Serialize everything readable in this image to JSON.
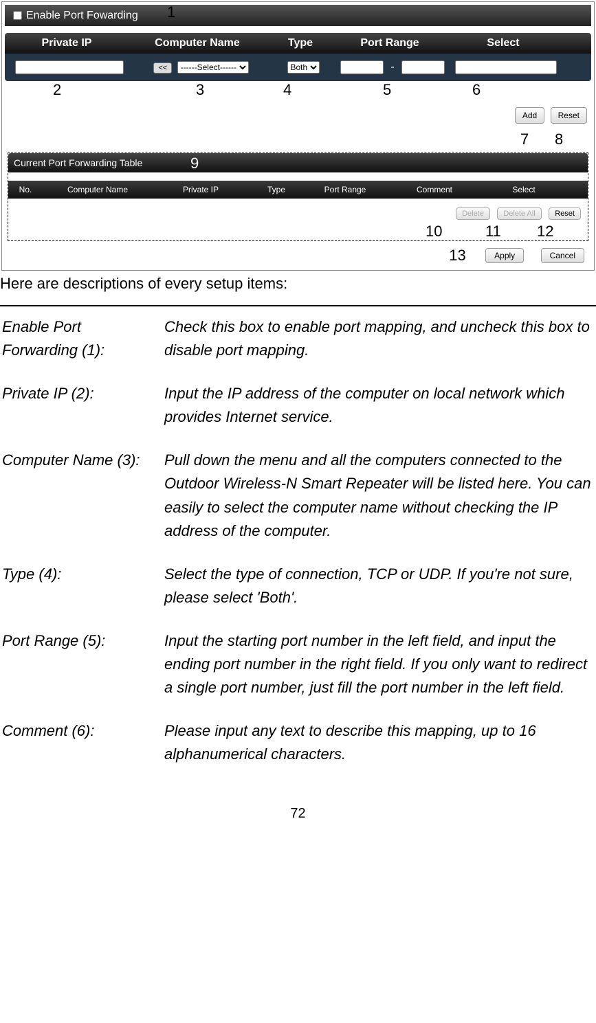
{
  "enable_checkbox_label": "Enable Port Fowarding",
  "callouts": {
    "c1": "1",
    "c2": "2",
    "c3": "3",
    "c4": "4",
    "c5": "5",
    "c6": "6",
    "c7": "7",
    "c8": "8",
    "c9": "9",
    "c10": "10",
    "c11": "11",
    "c12": "12",
    "c13": "13"
  },
  "headers": {
    "private_ip": "Private IP",
    "computer_name": "Computer Name",
    "type": "Type",
    "port_range": "Port Range",
    "select": "Select"
  },
  "form": {
    "fill_button": "<<",
    "computer_select_placeholder": "------Select------",
    "type_select_value": "Both",
    "port_dash": "-"
  },
  "buttons": {
    "add": "Add",
    "reset": "Reset",
    "delete": "Delete",
    "delete_all": "Delete All",
    "apply": "Apply",
    "cancel": "Cancel"
  },
  "table": {
    "title": "Current Port Forwarding Table",
    "headers": {
      "no": "No.",
      "computer_name": "Computer Name",
      "private_ip": "Private IP",
      "type": "Type",
      "port_range": "Port Range",
      "comment": "Comment",
      "select": "Select"
    }
  },
  "description_intro": "Here are descriptions of every setup items:",
  "descriptions": [
    {
      "term": "Enable Port Forwarding (1):",
      "desc": "Check this box to enable port mapping, and uncheck this box to disable port mapping."
    },
    {
      "term": "Private IP (2):",
      "desc": "Input the IP address of the computer on local network which provides Internet service."
    },
    {
      "term": "Computer Name (3):",
      "desc": "Pull down the menu and all the computers connected to the Outdoor Wireless-N Smart Repeater will be listed here. You can easily to select the computer name without checking the IP address of the computer."
    },
    {
      "term": "Type (4):",
      "desc": "Select the type of connection, TCP or UDP. If you're not sure, please select 'Both'."
    },
    {
      "term": "Port Range (5):",
      "desc": "Input the starting port number in the left field, and input the ending port number in the right field. If you only want to redirect a single port number, just fill the port number in the left field."
    },
    {
      "term": "Comment (6):",
      "desc": "Please input any text to describe this mapping, up to 16 alphanumerical characters."
    }
  ],
  "page_number": "72"
}
